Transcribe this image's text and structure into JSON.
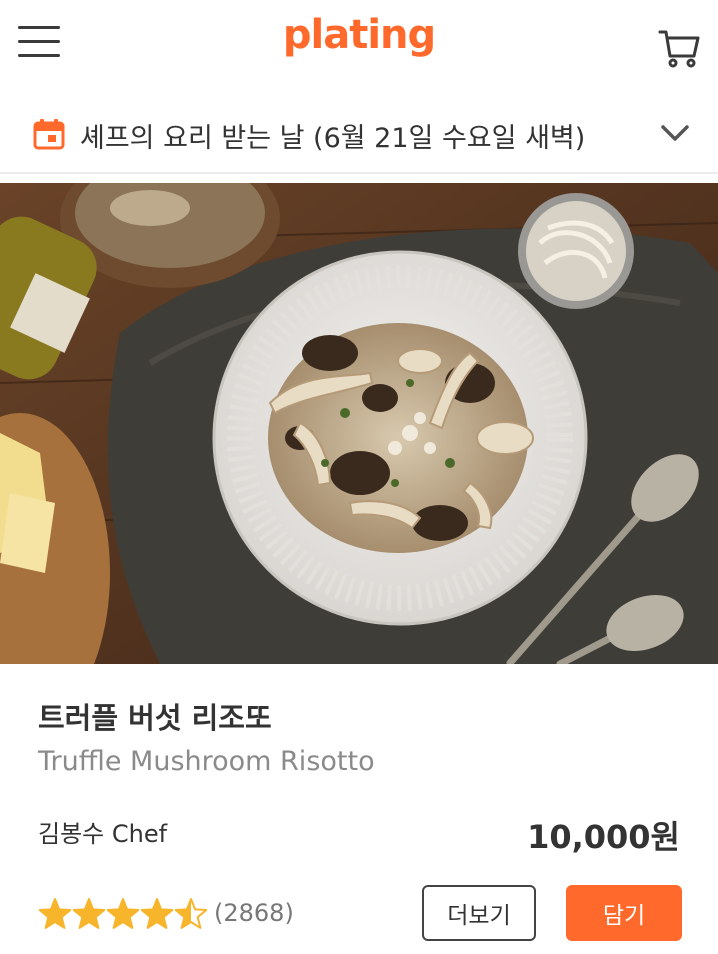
{
  "header": {
    "logo_text": "plating",
    "menu_icon": "hamburger-menu-icon",
    "cart_icon": "shopping-cart-icon"
  },
  "delivery": {
    "text": "셰프의 요리 받는 날 (6월 21일 수요일 새벽)",
    "calendar_icon": "calendar-icon",
    "expand_icon": "chevron-down-icon"
  },
  "product": {
    "image": "risotto-photo",
    "title_ko": "트러플 버섯 리조또",
    "title_en": "Truffle Mushroom Risotto",
    "chef": "김봉수 Chef",
    "price": "10,000원",
    "rating": 4.5,
    "rating_max": 5,
    "review_count": "(2868)",
    "more_label": "더보기",
    "add_label": "담기"
  },
  "colors": {
    "accent": "#ff6a2c",
    "star": "#f7b52c",
    "text": "#333333",
    "subtext": "#8a8a8a"
  }
}
